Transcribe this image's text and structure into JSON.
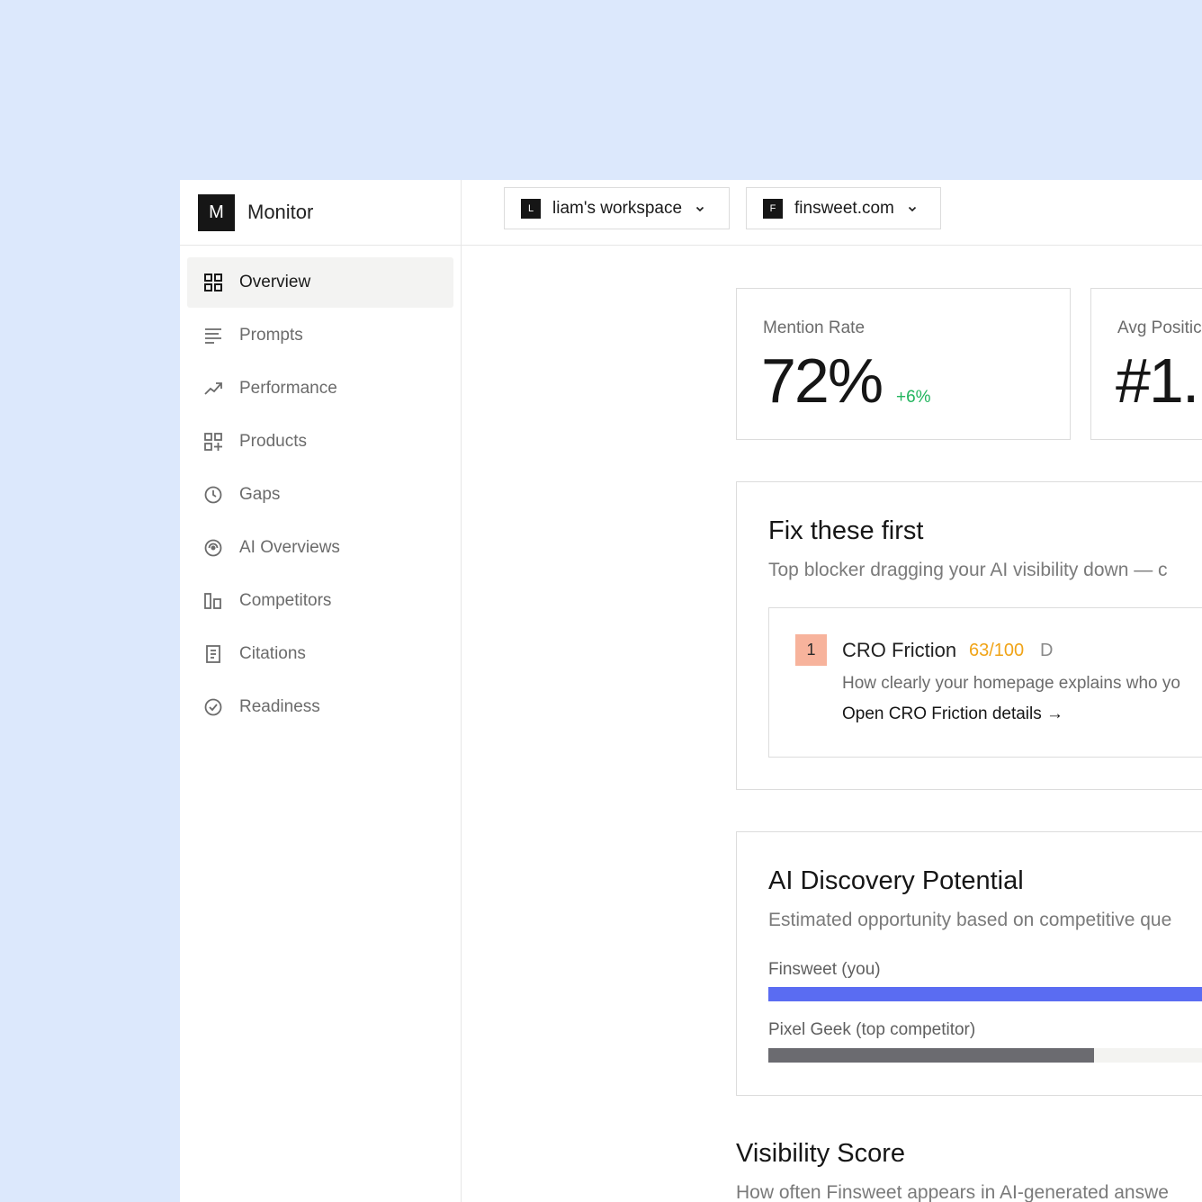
{
  "brand": {
    "logo_letter": "M",
    "name": "Monitor"
  },
  "sidebar": {
    "items": [
      {
        "label": "Overview",
        "icon": "grid-icon",
        "active": true
      },
      {
        "label": "Prompts",
        "icon": "lines-icon",
        "active": false
      },
      {
        "label": "Performance",
        "icon": "trending-up-icon",
        "active": false
      },
      {
        "label": "Products",
        "icon": "grid-plus-icon",
        "active": false
      },
      {
        "label": "Gaps",
        "icon": "clock-icon",
        "active": false
      },
      {
        "label": "AI Overviews",
        "icon": "radar-icon",
        "active": false
      },
      {
        "label": "Competitors",
        "icon": "bars-icon",
        "active": false
      },
      {
        "label": "Citations",
        "icon": "document-icon",
        "active": false
      },
      {
        "label": "Readiness",
        "icon": "check-circle-icon",
        "active": false
      }
    ]
  },
  "topbar": {
    "workspace": {
      "badge": "L",
      "label": "liam's workspace"
    },
    "site": {
      "badge": "F",
      "label": "finsweet.com"
    }
  },
  "metrics": {
    "mention_rate": {
      "label": "Mention Rate",
      "value": "72%",
      "delta": "+6%"
    },
    "avg_position": {
      "label": "Avg Positic",
      "value": "#1."
    }
  },
  "fix_first": {
    "title": "Fix these first",
    "subtitle": "Top blocker dragging your AI visibility down — c",
    "issue": {
      "rank": "1",
      "title": "CRO Friction",
      "score": "63/100",
      "grade": "D",
      "description": "How clearly your homepage explains who yo",
      "link": "Open CRO Friction details →"
    }
  },
  "discovery": {
    "title": "AI Discovery Potential",
    "subtitle": "Estimated opportunity based on competitive que",
    "bars": [
      {
        "label": "Finsweet (you)",
        "fraction": 1.0,
        "color": "#5a6cf2"
      },
      {
        "label": "Pixel Geek (top competitor)",
        "fraction": 0.604,
        "color": "#6b6b70"
      }
    ]
  },
  "visibility": {
    "title": "Visibility Score",
    "subtitle": "How often Finsweet appears in AI-generated answe"
  }
}
